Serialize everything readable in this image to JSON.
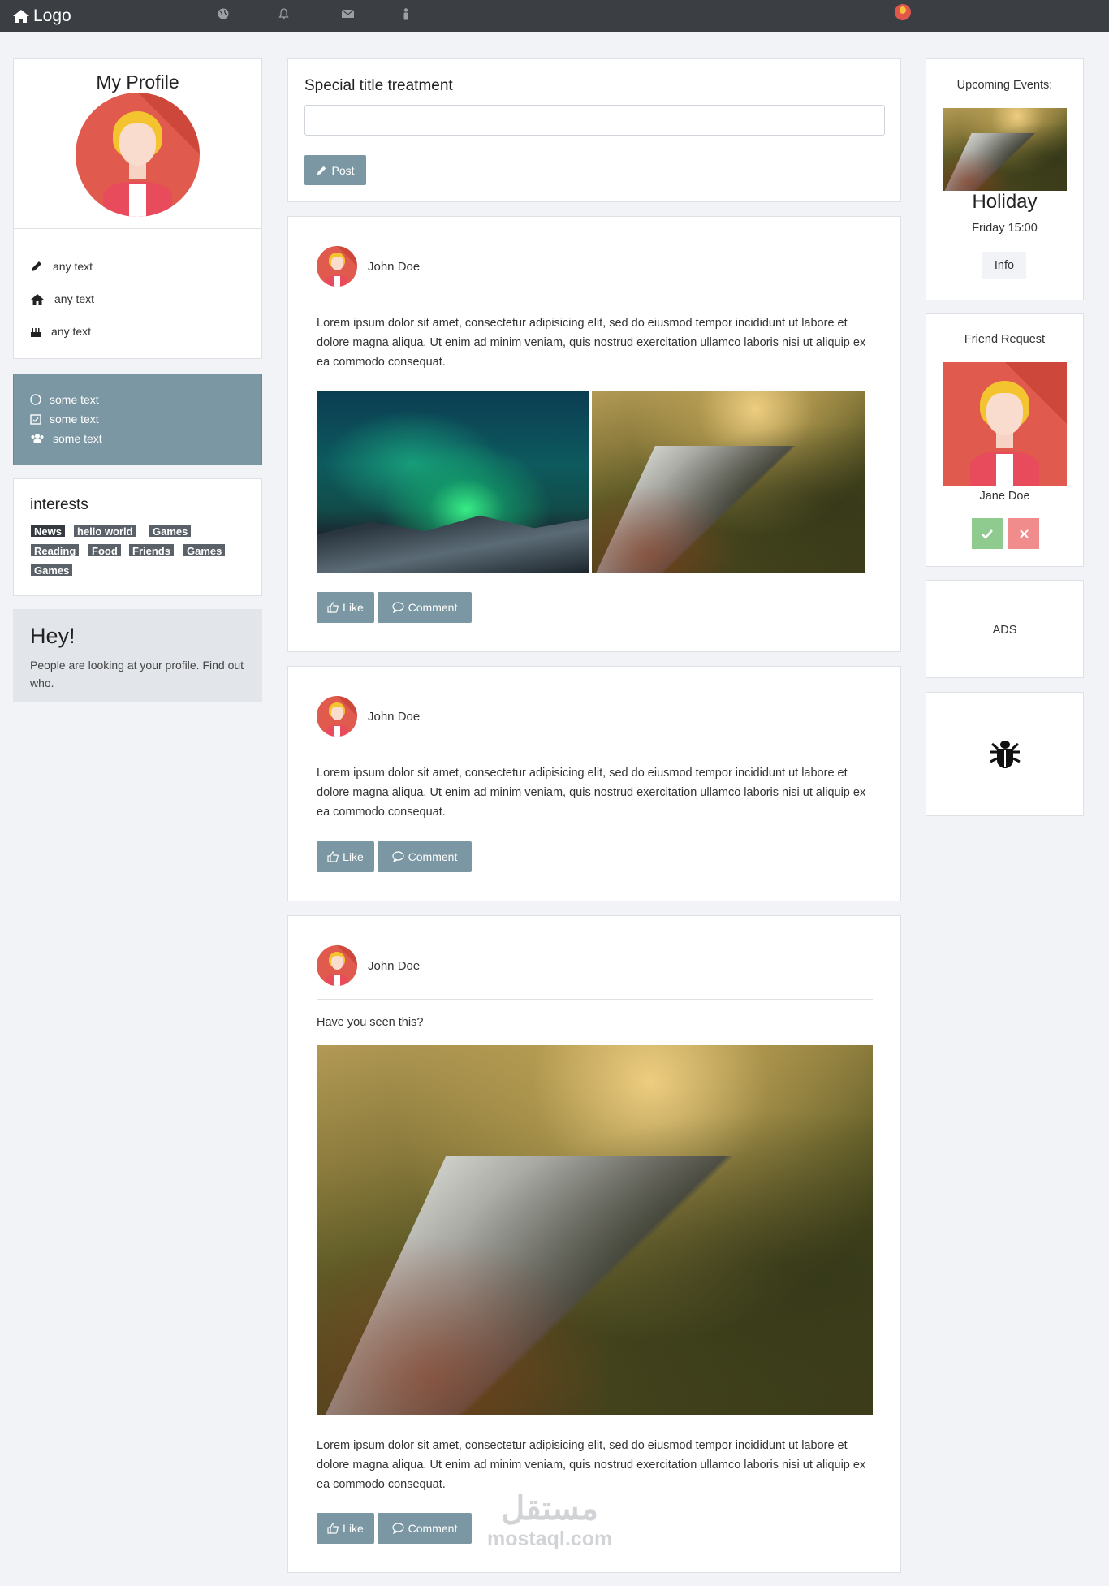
{
  "navbar": {
    "logo": "Logo",
    "icons": [
      "home-icon",
      "globe-icon",
      "bell-icon",
      "envelope-icon",
      "user-icon",
      "avatar"
    ]
  },
  "profile": {
    "title": "My Profile",
    "items": [
      {
        "icon": "pencil-icon",
        "label": "any text"
      },
      {
        "icon": "home-icon",
        "label": "any text"
      },
      {
        "icon": "birthday-cake-icon",
        "label": "any text"
      }
    ]
  },
  "grey_box": {
    "items": [
      {
        "icon": "circle-icon",
        "label": "some text"
      },
      {
        "icon": "calendar-check-icon",
        "label": "some text"
      },
      {
        "icon": "users-icon",
        "label": "some text"
      }
    ]
  },
  "interests": {
    "title": "interests",
    "tags": [
      "News",
      "hello world",
      "Games",
      "Reading",
      "Food",
      "Friends",
      "Games",
      "Games"
    ]
  },
  "hey": {
    "title": "Hey!",
    "text": "People are looking at your profile. Find out who."
  },
  "composer": {
    "title": "Special title treatment",
    "input_value": "",
    "post_label": "Post"
  },
  "posts": [
    {
      "author": "John Doe",
      "text": "Lorem ipsum dolor sit amet, consectetur adipisicing elit, sed do eiusmod tempor incididunt ut labore et dolore magna aliqua. Ut enim ad minim veniam, quis nostrud exercitation ullamco laboris nisi ut aliquip ex ea commodo consequat.",
      "like_label": "Like",
      "comment_label": "Comment"
    },
    {
      "author": "John Doe",
      "text": "Lorem ipsum dolor sit amet, consectetur adipisicing elit, sed do eiusmod tempor incididunt ut labore et dolore magna aliqua. Ut enim ad minim veniam, quis nostrud exercitation ullamco laboris nisi ut aliquip ex ea commodo consequat.",
      "like_label": "Like",
      "comment_label": "Comment"
    },
    {
      "author": "John Doe",
      "intro": "Have you seen this?",
      "text": "Lorem ipsum dolor sit amet, consectetur adipisicing elit, sed do eiusmod tempor incididunt ut labore et dolore magna aliqua. Ut enim ad minim veniam, quis nostrud exercitation ullamco laboris nisi ut aliquip ex ea commodo consequat.",
      "like_label": "Like",
      "comment_label": "Comment"
    }
  ],
  "events": {
    "title": "Upcoming Events:",
    "event_name": "Holiday",
    "event_time": "Friday 15:00",
    "info_label": "Info"
  },
  "friend_request": {
    "title": "Friend Request",
    "name": "Jane Doe",
    "accept_icon": "check-icon",
    "reject_icon": "close-icon"
  },
  "ads": {
    "label": "ADS"
  },
  "bug_card": {
    "icon": "bug-icon"
  },
  "watermark": {
    "arabic": "مستقل",
    "latin": "mostaql.com"
  },
  "colors": {
    "navbar": "#3b3f44",
    "accent": "#7b97a3",
    "accept": "#8fcb8f",
    "reject": "#f08c8c",
    "tag": "#5a6169"
  }
}
